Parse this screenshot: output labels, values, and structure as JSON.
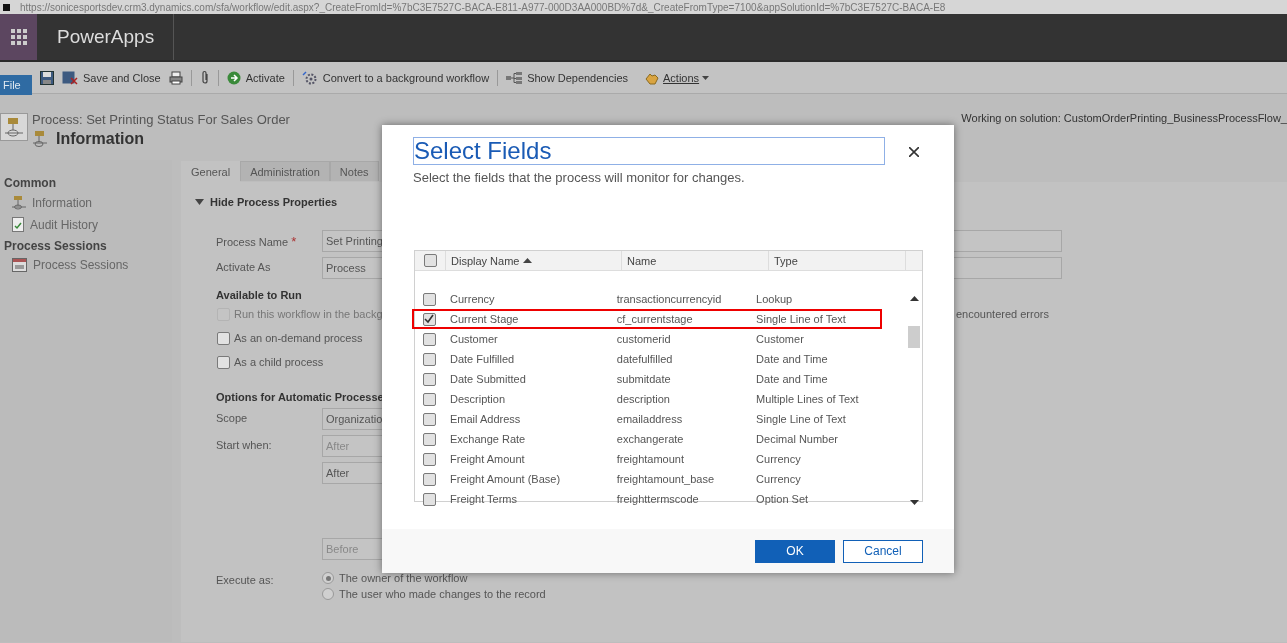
{
  "url_bar": {
    "url": "https://sonicesportsdev.crm3.dynamics.com/sfa/workflow/edit.aspx?_CreateFromId=%7bC3E7527C-BACA-E811-A977-000D3AA000BD%7d&_CreateFromType=7100&appSolutionId=%7bC3E7527C-BACA-E8"
  },
  "app_bar": {
    "title": "PowerApps"
  },
  "toolbar": {
    "file": "File",
    "save_and_close": "Save and Close",
    "activate": "Activate",
    "convert": "Convert to a background workflow",
    "show_dependencies": "Show Dependencies",
    "actions": "Actions"
  },
  "header": {
    "breadcrumb": "Process: Set Printing Status For Sales Order",
    "title": "Information",
    "solution": "Working on solution: CustomOrderPrinting_BusinessProcessFlow_"
  },
  "sidebar": {
    "sections": [
      {
        "title": "Common",
        "items": [
          {
            "label": "Information",
            "kind": "info"
          },
          {
            "label": "Audit History",
            "kind": "audit"
          }
        ]
      },
      {
        "title": "Process Sessions",
        "items": [
          {
            "label": "Process Sessions",
            "kind": "sessions"
          }
        ]
      }
    ]
  },
  "tabs": [
    {
      "label": "General",
      "selected": true
    },
    {
      "label": "Administration",
      "selected": false
    },
    {
      "label": "Notes",
      "selected": false
    }
  ],
  "form": {
    "section_title": "Hide Process Properties",
    "expanded": true,
    "process_name": {
      "label": "Process Name",
      "required_mark": "*",
      "value": "Set Printing"
    },
    "activate_as": {
      "label": "Activate As",
      "value": "Process"
    },
    "available_title": "Available to Run",
    "available": [
      {
        "label": "Run this workflow in the backg",
        "label_tail": "encountered errors",
        "checked": false,
        "disabled": true
      },
      {
        "label": "As an on-demand process",
        "checked": false,
        "disabled": false
      },
      {
        "label": "As a child process",
        "checked": false,
        "disabled": false
      }
    ],
    "automatic_title": "Options for Automatic Processe",
    "scope": {
      "label": "Scope",
      "value": "Organizatio"
    },
    "start_when": {
      "label": "Start when:",
      "values": [
        {
          "value": "After",
          "disabled": true
        },
        {
          "value": "After",
          "disabled": false
        }
      ]
    },
    "before": {
      "value": "Before",
      "disabled": true
    },
    "execute_as": {
      "label": "Execute as:",
      "options": [
        {
          "label": "The owner of the workflow",
          "selected": true
        },
        {
          "label": "The user who made changes to the record",
          "selected": false
        }
      ]
    }
  },
  "dialog": {
    "title": "Select Fields",
    "subtitle": "Select the fields that the process will monitor for changes.",
    "columns": [
      {
        "label": "Display Name",
        "sorted": true
      },
      {
        "label": "Name",
        "sorted": false
      },
      {
        "label": "Type",
        "sorted": false
      }
    ],
    "select_all": false,
    "rows": [
      {
        "display_name": "Currency",
        "name": "transactioncurrencyid",
        "type": "Lookup",
        "checked": false,
        "highlighted": false
      },
      {
        "display_name": "Current Stage",
        "name": "cf_currentstage",
        "type": "Single Line of Text",
        "checked": true,
        "highlighted": true
      },
      {
        "display_name": "Customer",
        "name": "customerid",
        "type": "Customer",
        "checked": false,
        "highlighted": false
      },
      {
        "display_name": "Date Fulfilled",
        "name": "datefulfilled",
        "type": "Date and Time",
        "checked": false,
        "highlighted": false
      },
      {
        "display_name": "Date Submitted",
        "name": "submitdate",
        "type": "Date and Time",
        "checked": false,
        "highlighted": false
      },
      {
        "display_name": "Description",
        "name": "description",
        "type": "Multiple Lines of Text",
        "checked": false,
        "highlighted": false
      },
      {
        "display_name": "Email Address",
        "name": "emailaddress",
        "type": "Single Line of Text",
        "checked": false,
        "highlighted": false
      },
      {
        "display_name": "Exchange Rate",
        "name": "exchangerate",
        "type": "Decimal Number",
        "checked": false,
        "highlighted": false
      },
      {
        "display_name": "Freight Amount",
        "name": "freightamount",
        "type": "Currency",
        "checked": false,
        "highlighted": false
      },
      {
        "display_name": "Freight Amount (Base)",
        "name": "freightamount_base",
        "type": "Currency",
        "checked": false,
        "highlighted": false
      },
      {
        "display_name": "Freight Terms",
        "name": "freighttermscode",
        "type": "Option Set",
        "checked": false,
        "highlighted": false
      }
    ],
    "ok": "OK",
    "cancel": "Cancel"
  }
}
